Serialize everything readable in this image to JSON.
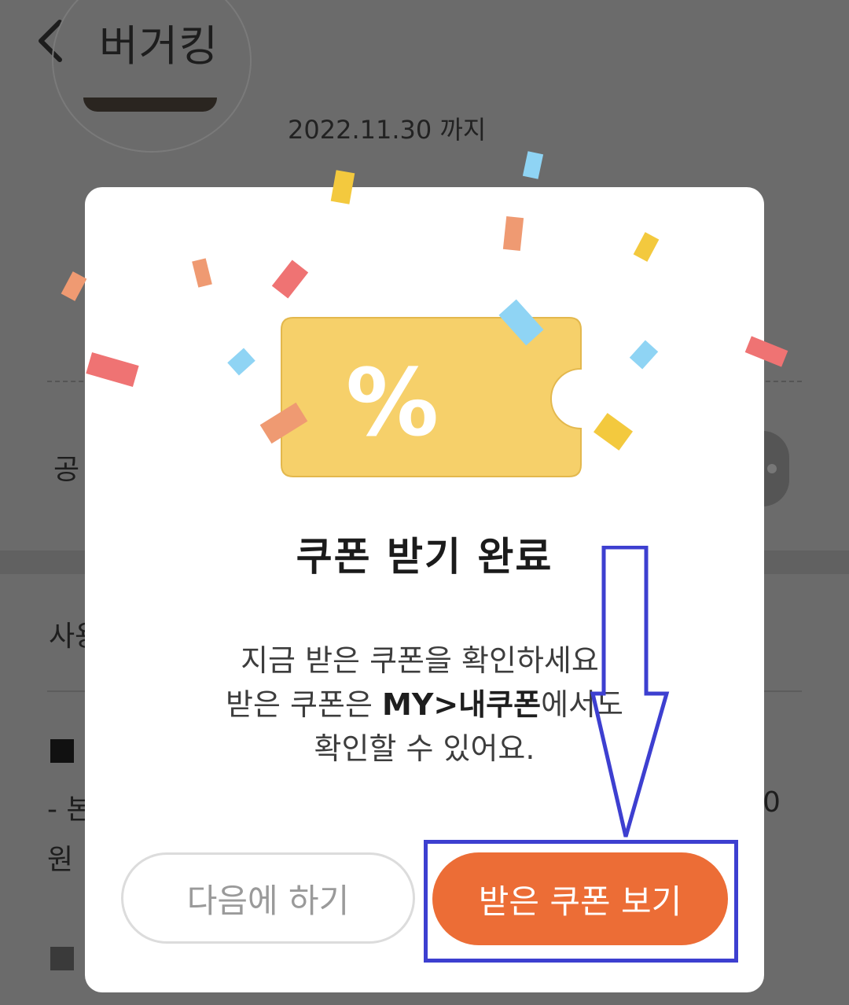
{
  "header": {
    "title": "버거킹"
  },
  "coupon_info": {
    "expiry": "2022.11.30 까지"
  },
  "background": {
    "share_label": "공",
    "usage_label": "사용",
    "note_line1": "- 본",
    "note_line2": "원 ",
    "note_right": "0"
  },
  "modal": {
    "coupon_symbol": "%",
    "title": "쿠폰 받기 완료",
    "desc_line1": "지금 받은 쿠폰을 확인하세요.",
    "desc_line2_pre": "받은 쿠폰은 ",
    "desc_line2_bold": "MY>내쿠폰",
    "desc_line2_post": "에서도",
    "desc_line3": "확인할 수 있어요.",
    "later_button": "다음에 하기",
    "view_button": "받은 쿠폰 보기"
  },
  "colors": {
    "accent": "#ec6d36",
    "coupon": "#f6d06a",
    "annotation": "#3d3fd0",
    "overlay": "#6b6b6b"
  }
}
